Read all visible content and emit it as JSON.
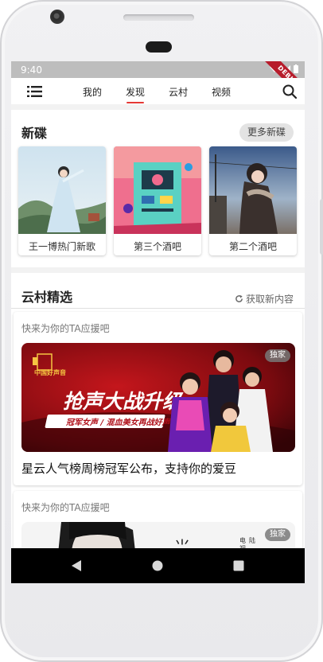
{
  "status": {
    "time": "9:40",
    "debug_label": "DEBUG"
  },
  "appbar": {
    "tabs": [
      {
        "label": "我的",
        "active": false
      },
      {
        "label": "发现",
        "active": true
      },
      {
        "label": "云村",
        "active": false
      },
      {
        "label": "视频",
        "active": false
      }
    ],
    "accent_color": "#e53935"
  },
  "new_albums": {
    "title": "新碟",
    "more_label": "更多新碟",
    "items": [
      {
        "name": "王一博热门新歌"
      },
      {
        "name": "第三个酒吧"
      },
      {
        "name": "第二个酒吧"
      }
    ]
  },
  "cloud_village": {
    "title": "云村精选",
    "refresh_label": "获取新内容",
    "cards": [
      {
        "hint": "快来为你的TA应援吧",
        "badge": "独家",
        "banner_headline": "抢声大战升级",
        "banner_subline": "冠军女声 / 混血美女再战好声音",
        "banner_logo": "中国好声音",
        "title": "星云人气榜周榜冠军公布，支持你的爱豆"
      },
      {
        "hint": "快来为你的TA应援吧",
        "badge": "独家"
      }
    ]
  }
}
